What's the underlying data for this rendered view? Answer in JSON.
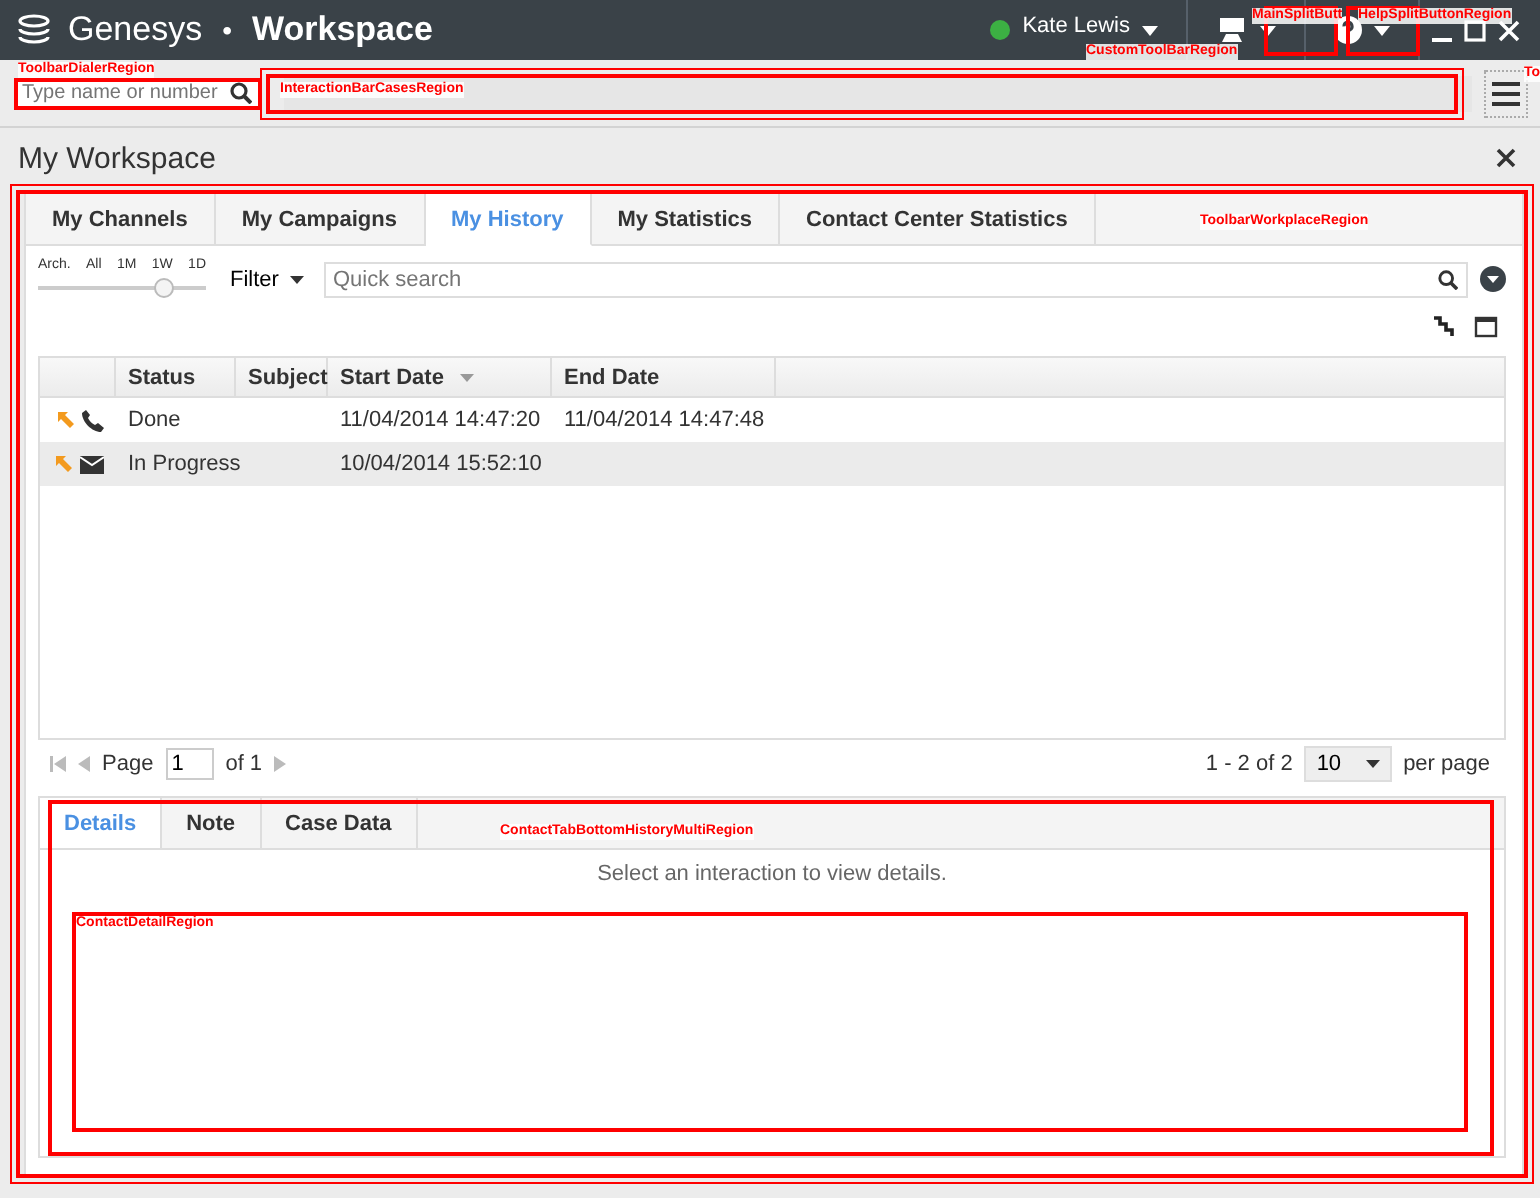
{
  "title_bar": {
    "brand": "Genesys",
    "separator": "•",
    "app": "Workspace",
    "user": {
      "name": "Kate Lewis",
      "available": true
    }
  },
  "toolbar": {
    "dialer": {
      "placeholder": "Type name or number"
    }
  },
  "workspace": {
    "title": "My Workspace",
    "tabs": [
      {
        "label": "My Channels",
        "selected": false
      },
      {
        "label": "My Campaigns",
        "selected": false
      },
      {
        "label": "My History",
        "selected": true
      },
      {
        "label": "My Statistics",
        "selected": false
      },
      {
        "label": "Contact Center Statistics",
        "selected": false
      }
    ],
    "timeline": {
      "marks": [
        "Arch.",
        "All",
        "1M",
        "1W",
        "1D"
      ],
      "level": 0.75
    },
    "filter": "Filter",
    "search": {
      "placeholder": "Quick search"
    },
    "table": {
      "columns": [
        {
          "label": "Status"
        },
        {
          "label": "Subject"
        },
        {
          "label": "Start Date",
          "sorted": true
        },
        {
          "label": "End Date"
        }
      ],
      "rows": [
        {
          "kind": "call",
          "status": "Done",
          "subject": "",
          "start": "11/04/2014 14:47:20",
          "end": "11/04/2014 14:47:48",
          "selected": false
        },
        {
          "kind": "email",
          "status": "In Progress",
          "subject": "",
          "start": "10/04/2014 15:52:10",
          "end": "",
          "selected": true
        }
      ]
    },
    "pager": {
      "page_label": "Page",
      "page": "1",
      "of": "of 1",
      "range": "1 - 2 of 2",
      "per_page": "10",
      "per_page_label": "per page"
    },
    "detail": {
      "tabs": [
        {
          "label": "Details",
          "selected": true
        },
        {
          "label": "Note",
          "selected": false
        },
        {
          "label": "Case Data",
          "selected": false
        }
      ],
      "message": "Select an interaction to view details."
    }
  },
  "region_overlays": [
    {
      "label": "ToolbarDialerRegion"
    },
    {
      "label": "InteractionBarCasesRegion"
    },
    {
      "label": "CustomToolBarRegion"
    },
    {
      "label": "MainSplitButt"
    },
    {
      "label": "HelpSplitButtonRegion"
    },
    {
      "label": "To"
    },
    {
      "label": "ToolbarWorkplaceRegion"
    },
    {
      "label": "ContactTabBottomHistoryMultiRegion"
    },
    {
      "label": "ContactDetailRegion"
    }
  ]
}
